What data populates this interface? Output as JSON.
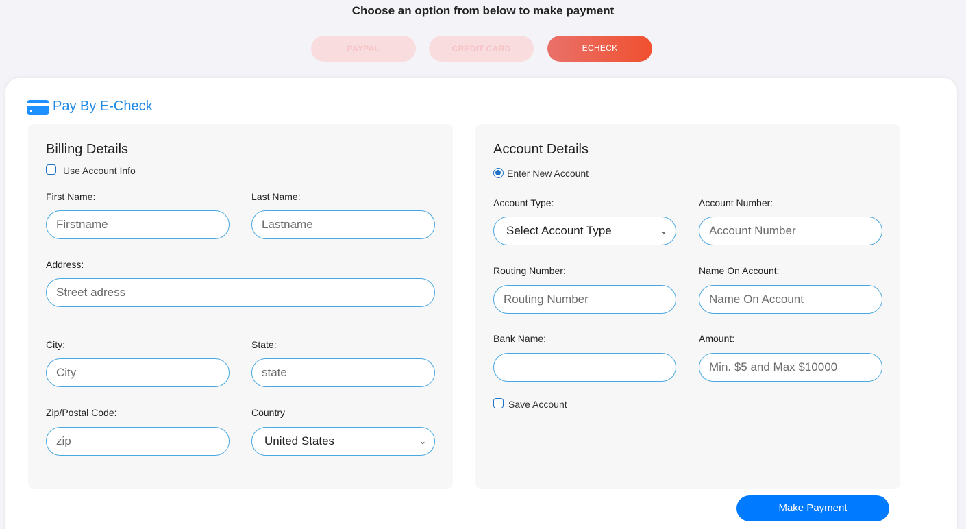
{
  "heading": "Choose an option from below to make payment",
  "tabs": [
    {
      "label": "PAYPAL",
      "active": false
    },
    {
      "label": "CREDIT CARD",
      "active": false
    },
    {
      "label": "ECHECK",
      "active": true
    }
  ],
  "card": {
    "icon": "credit-card-icon",
    "title": "Pay By E-Check"
  },
  "billing": {
    "title": "Billing Details",
    "use_account_info": {
      "label": "Use Account Info",
      "checked": false
    },
    "first_name": {
      "label": "First Name:",
      "placeholder": "Firstname"
    },
    "last_name": {
      "label": "Last Name:",
      "placeholder": "Lastname"
    },
    "address": {
      "label": "Address:",
      "placeholder": "Street adress"
    },
    "city": {
      "label": "City:",
      "placeholder": "City"
    },
    "state": {
      "label": "State:",
      "placeholder": "state"
    },
    "zip": {
      "label": "Zip/Postal Code:",
      "placeholder": "zip"
    },
    "country": {
      "label": "Country",
      "value": "United States"
    }
  },
  "account": {
    "title": "Account Details",
    "enter_new": {
      "label": "Enter New Account",
      "selected": true
    },
    "account_type": {
      "label": "Account Type:",
      "value": "Select Account Type"
    },
    "account_number": {
      "label": "Account Number:",
      "placeholder": "Account Number"
    },
    "routing_number": {
      "label": "Routing Number:",
      "placeholder": "Routing Number"
    },
    "name_on_account": {
      "label": "Name On Account:",
      "placeholder": "Name On Account"
    },
    "bank_name": {
      "label": "Bank Name:",
      "placeholder": ""
    },
    "amount": {
      "label": "Amount:",
      "placeholder": "Min. $5 and Max $10000"
    },
    "save_account": {
      "label": "Save Account",
      "checked": false
    }
  },
  "submit_label": "Make Payment",
  "colors": {
    "accent_blue": "#007bff",
    "title_blue": "#1e88e5",
    "field_border": "#4aa8e0",
    "echeck_gradient_start": "#e9716a",
    "echeck_gradient_end": "#f0502f",
    "inactive_tab": "#f8dcde"
  }
}
